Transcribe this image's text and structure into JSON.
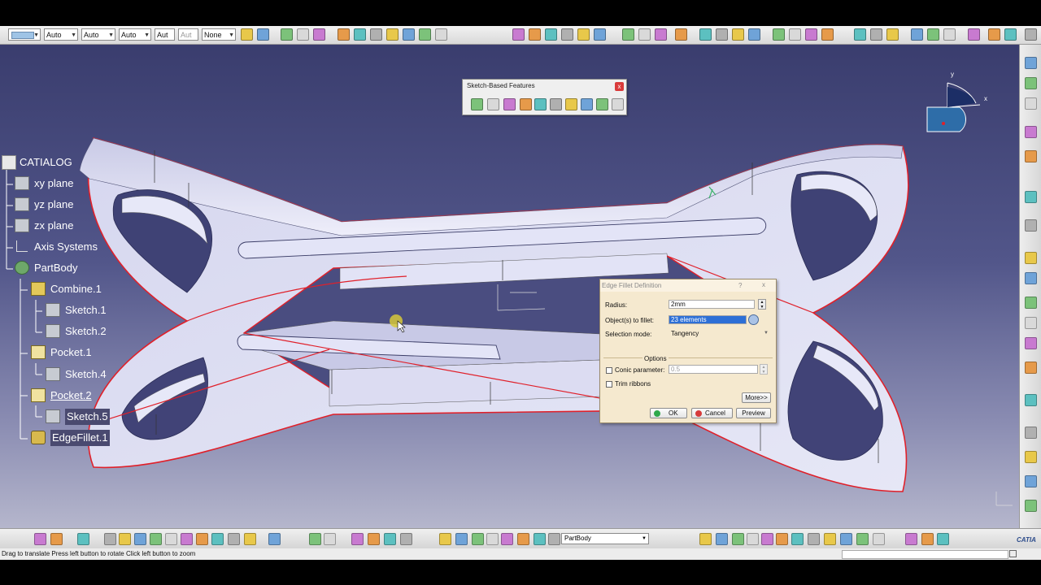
{
  "top_toolbar": {
    "color_value": "",
    "linetype": "Auto",
    "thickness": "Auto",
    "point_style": "Auto",
    "layer_a": "Aut",
    "layer_b": "Aut",
    "layer_none": "None"
  },
  "tree": {
    "root": "CATIALOG",
    "items": [
      {
        "label": "xy plane"
      },
      {
        "label": "yz plane"
      },
      {
        "label": "zx plane"
      },
      {
        "label": "Axis Systems"
      },
      {
        "label": "PartBody"
      },
      {
        "label": "Combine.1"
      },
      {
        "label": "Sketch.1"
      },
      {
        "label": "Sketch.2"
      },
      {
        "label": "Pocket.1"
      },
      {
        "label": "Sketch.4"
      },
      {
        "label": "Pocket.2"
      },
      {
        "label": "Sketch.5"
      },
      {
        "label": "EdgeFillet.1"
      }
    ]
  },
  "sketch_toolbar": {
    "title": "Sketch-Based Features",
    "close": "x"
  },
  "dialog": {
    "title": "Edge Fillet Definition",
    "help": "?",
    "close": "x",
    "radius_label": "Radius:",
    "radius_value": "2mm",
    "objects_label": "Object(s) to fillet:",
    "objects_value": "23 elements",
    "selmode_label": "Selection mode:",
    "selmode_value": "Tangency",
    "options_label": "Options",
    "conic_label": "Conic parameter:",
    "conic_value": "0.5",
    "trim_label": "Trim ribbons",
    "more_button": "More>>",
    "ok_button": "OK",
    "cancel_button": "Cancel",
    "preview_button": "Preview"
  },
  "bottom_toolbar": {
    "body_select": "PartBody"
  },
  "compass": {
    "x_label": "x",
    "y_label": "y"
  },
  "status": {
    "message": "Drag to translate  Press left button to rotate  Click left button to zoom"
  },
  "logo": {
    "text": "CATIA"
  },
  "colors": {
    "edge_red": "#e0202a",
    "part_face": "#d8d9f0",
    "viewport_top": "#3a3d6e",
    "dialog_bg": "#f5e9cf"
  }
}
